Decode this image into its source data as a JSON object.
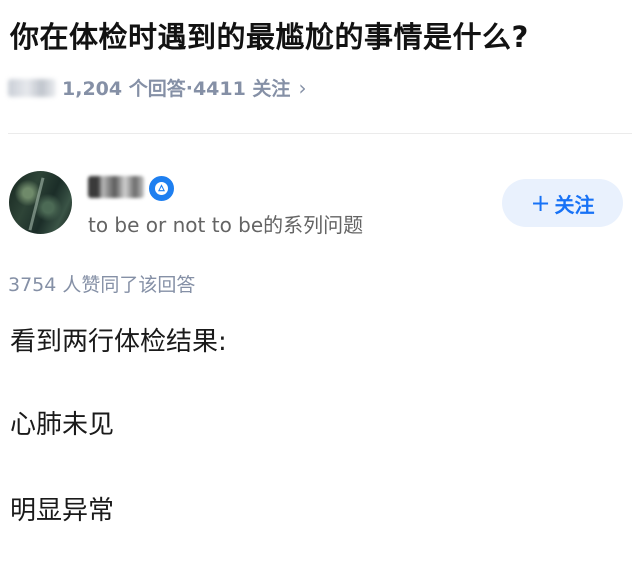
{
  "question": {
    "title": "你在体检时遇到的最尴尬的事情是什么?",
    "answer_count": "1,204 个回答",
    "separator": "·",
    "follower_count": "4411 关注",
    "chevron": "›"
  },
  "author": {
    "bio": "to be or not to be的系列问题",
    "follow_label": "关注",
    "follow_icon": "+"
  },
  "answer": {
    "votes": "3754 人赞同了该回答",
    "lines": [
      "看到两行体检结果:",
      "心肺未见",
      "明显异常"
    ]
  },
  "colors": {
    "accent": "#1772f6",
    "muted": "#8590a6",
    "follow_bg": "#e9f1fd",
    "badge": "#1e7ff0"
  }
}
